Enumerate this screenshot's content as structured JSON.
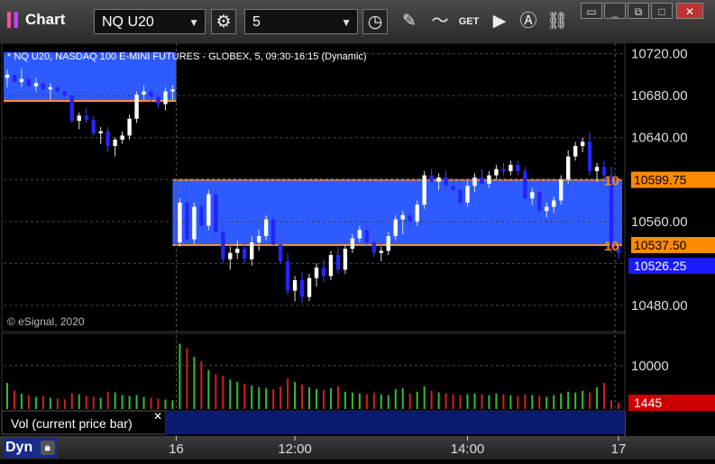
{
  "app": {
    "title": "Chart"
  },
  "toolbar": {
    "symbol": "NQ U20",
    "interval": "5"
  },
  "chart_data": {
    "type": "candlestick",
    "title": "* NQ U20, NASDAQ 100 E-MINI FUTURES - GLOBEX, 5, 09:30-16:15 (Dynamic)",
    "copyright": "© eSignal, 2020",
    "x_ticks": [
      "16",
      "12:00",
      "14:00",
      "17"
    ],
    "y_ticks": [
      "10720.00",
      "10680.00",
      "10640.00",
      "10600.00",
      "10560.00",
      "10520.00",
      "10480.00"
    ],
    "y_range": [
      10455,
      10730
    ],
    "price_lines": [
      {
        "label": "10",
        "value_text": "10599.75",
        "value": 10599.75
      },
      {
        "label": "10",
        "value_text": "10537.50",
        "value": 10537.5
      }
    ],
    "last_price": {
      "text": "10526.25",
      "value": 10526.25
    },
    "last_close_prev": {
      "value": 10675
    },
    "candles": [
      [
        10697,
        10705,
        10688,
        10700
      ],
      [
        10700,
        10702,
        10690,
        10693
      ],
      [
        10693,
        10706,
        10688,
        10696
      ],
      [
        10696,
        10699,
        10686,
        10689
      ],
      [
        10689,
        10697,
        10684,
        10692
      ],
      [
        10692,
        10694,
        10682,
        10686
      ],
      [
        10686,
        10692,
        10676,
        10688
      ],
      [
        10688,
        10692,
        10682,
        10684
      ],
      [
        10684,
        10686,
        10676,
        10680
      ],
      [
        10680,
        10685,
        10654,
        10656
      ],
      [
        10656,
        10664,
        10648,
        10661
      ],
      [
        10661,
        10668,
        10654,
        10657
      ],
      [
        10657,
        10660,
        10642,
        10644
      ],
      [
        10644,
        10650,
        10634,
        10646
      ],
      [
        10646,
        10650,
        10626,
        10632
      ],
      [
        10632,
        10640,
        10622,
        10638
      ],
      [
        10638,
        10646,
        10634,
        10642
      ],
      [
        10642,
        10662,
        10638,
        10658
      ],
      [
        10658,
        10684,
        10654,
        10681
      ],
      [
        10681,
        10690,
        10676,
        10684
      ],
      [
        10684,
        10688,
        10674,
        10679
      ],
      [
        10679,
        10682,
        10668,
        10672
      ],
      [
        10672,
        10688,
        10666,
        10684
      ],
      [
        10684,
        10690,
        10676,
        10686
      ],
      [
        10540,
        10582,
        10536,
        10578
      ],
      [
        10578,
        10592,
        10540,
        10543
      ],
      [
        10543,
        10578,
        10538,
        10574
      ],
      [
        10574,
        10588,
        10552,
        10556
      ],
      [
        10556,
        10590,
        10552,
        10586
      ],
      [
        10586,
        10591,
        10546,
        10550
      ],
      [
        10550,
        10560,
        10520,
        10524
      ],
      [
        10524,
        10536,
        10514,
        10530
      ],
      [
        10530,
        10542,
        10524,
        10534
      ],
      [
        10534,
        10540,
        10520,
        10524
      ],
      [
        10524,
        10546,
        10518,
        10540
      ],
      [
        10540,
        10552,
        10532,
        10546
      ],
      [
        10546,
        10566,
        10542,
        10562
      ],
      [
        10562,
        10568,
        10536,
        10538
      ],
      [
        10538,
        10550,
        10520,
        10522
      ],
      [
        10522,
        10530,
        10490,
        10494
      ],
      [
        10494,
        10508,
        10484,
        10504
      ],
      [
        10504,
        10512,
        10482,
        10488
      ],
      [
        10488,
        10510,
        10484,
        10506
      ],
      [
        10506,
        10520,
        10498,
        10516
      ],
      [
        10516,
        10524,
        10502,
        10508
      ],
      [
        10508,
        10532,
        10504,
        10528
      ],
      [
        10528,
        10536,
        10510,
        10514
      ],
      [
        10514,
        10538,
        10510,
        10534
      ],
      [
        10534,
        10548,
        10530,
        10544
      ],
      [
        10544,
        10556,
        10540,
        10552
      ],
      [
        10552,
        10558,
        10536,
        10540
      ],
      [
        10540,
        10546,
        10526,
        10530
      ],
      [
        10530,
        10536,
        10522,
        10532
      ],
      [
        10532,
        10550,
        10528,
        10546
      ],
      [
        10546,
        10566,
        10542,
        10562
      ],
      [
        10562,
        10570,
        10548,
        10566
      ],
      [
        10566,
        10572,
        10554,
        10560
      ],
      [
        10560,
        10580,
        10556,
        10576
      ],
      [
        10576,
        10608,
        10572,
        10604
      ],
      [
        10604,
        10610,
        10596,
        10598
      ],
      [
        10598,
        10606,
        10590,
        10602
      ],
      [
        10602,
        10608,
        10590,
        10594
      ],
      [
        10594,
        10600,
        10586,
        10590
      ],
      [
        10590,
        10598,
        10574,
        10578
      ],
      [
        10578,
        10598,
        10574,
        10594
      ],
      [
        10594,
        10606,
        10588,
        10602
      ],
      [
        10602,
        10610,
        10592,
        10596
      ],
      [
        10596,
        10608,
        10592,
        10604
      ],
      [
        10604,
        10614,
        10600,
        10610
      ],
      [
        10610,
        10616,
        10604,
        10608
      ],
      [
        10608,
        10618,
        10604,
        10614
      ],
      [
        10614,
        10618,
        10604,
        10608
      ],
      [
        10608,
        10612,
        10578,
        10582
      ],
      [
        10582,
        10592,
        10576,
        10588
      ],
      [
        10588,
        10596,
        10566,
        10570
      ],
      [
        10570,
        10578,
        10564,
        10574
      ],
      [
        10574,
        10584,
        10568,
        10580
      ],
      [
        10580,
        10604,
        10576,
        10600
      ],
      [
        10600,
        10628,
        10596,
        10622
      ],
      [
        10622,
        10636,
        10618,
        10632
      ],
      [
        10632,
        10640,
        10626,
        10636
      ],
      [
        10636,
        10645,
        10604,
        10608
      ],
      [
        10608,
        10616,
        10598,
        10612
      ],
      [
        10612,
        10618,
        10600,
        10604
      ],
      [
        10604,
        10612,
        10530,
        10536
      ],
      [
        10536,
        10542,
        10524,
        10530
      ]
    ],
    "volume": {
      "label": "Vol (current price bar)",
      "y_ticks": [
        "10000"
      ],
      "y_range": [
        0,
        17000
      ],
      "last_text": "1445",
      "values": [
        6000,
        4200,
        3500,
        3200,
        2800,
        3000,
        2600,
        2400,
        2200,
        3600,
        3400,
        3000,
        2800,
        2600,
        4000,
        3800,
        3200,
        3000,
        3200,
        2800,
        2600,
        2400,
        2200,
        2000,
        15000,
        14000,
        12000,
        11000,
        9000,
        8000,
        7600,
        6800,
        6200,
        5800,
        5400,
        5000,
        4800,
        4600,
        5200,
        7000,
        6200,
        5600,
        5000,
        4600,
        4400,
        4800,
        5200,
        4000,
        3800,
        3600,
        3400,
        3800,
        3400,
        3200,
        4600,
        4800,
        3600,
        4000,
        5200,
        4200,
        3800,
        3600,
        3400,
        3200,
        3400,
        3600,
        3400,
        3200,
        3600,
        3400,
        3200,
        3000,
        3400,
        3200,
        3000,
        2800,
        3200,
        3600,
        4000,
        3800,
        4200,
        3800,
        5000,
        6000,
        2000,
        1445
      ]
    }
  },
  "statusbar": {
    "study_label": "Vol (current price bar)",
    "mode": "Dyn"
  }
}
